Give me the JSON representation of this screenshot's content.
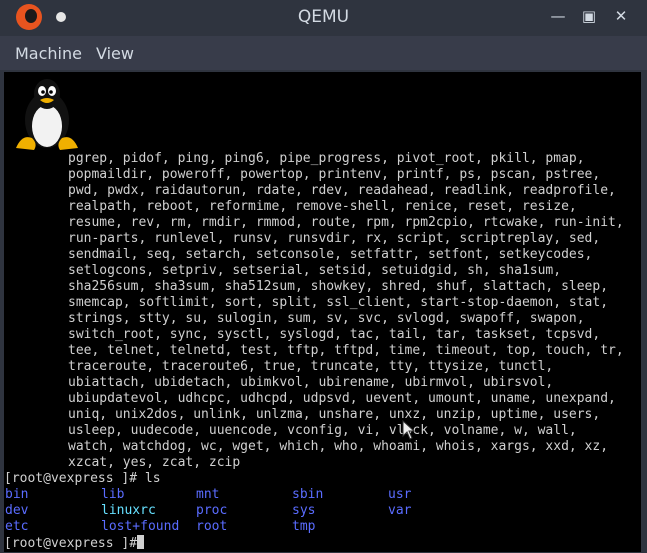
{
  "window": {
    "title": "QEMU",
    "buttons": {
      "minimize": "—",
      "maximize": "▣",
      "close": "✕"
    }
  },
  "menubar": {
    "items": [
      "Machine",
      "View"
    ]
  },
  "console": {
    "busybox_lines": [
      "pgrep, pidof, ping, ping6, pipe_progress, pivot_root, pkill, pmap,",
      "popmaildir, poweroff, powertop, printenv, printf, ps, pscan, pstree,",
      "pwd, pwdx, raidautorun, rdate, rdev, readahead, readlink, readprofile,",
      "realpath, reboot, reformime, remove-shell, renice, reset, resize,",
      "resume, rev, rm, rmdir, rmmod, route, rpm, rpm2cpio, rtcwake, run-init,",
      "run-parts, runlevel, runsv, runsvdir, rx, script, scriptreplay, sed,",
      "sendmail, seq, setarch, setconsole, setfattr, setfont, setkeycodes,",
      "setlogcons, setpriv, setserial, setsid, setuidgid, sh, sha1sum,",
      "sha256sum, sha3sum, sha512sum, showkey, shred, shuf, slattach, sleep,",
      "smemcap, softlimit, sort, split, ssl_client, start-stop-daemon, stat,",
      "strings, stty, su, sulogin, sum, sv, svc, svlogd, swapoff, swapon,",
      "switch_root, sync, sysctl, syslogd, tac, tail, tar, taskset, tcpsvd,",
      "tee, telnet, telnetd, test, tftp, tftpd, time, timeout, top, touch, tr,",
      "traceroute, traceroute6, true, truncate, tty, ttysize, tunctl,",
      "ubiattach, ubidetach, ubimkvol, ubirename, ubirmvol, ubirsvol,",
      "ubiupdatevol, udhcpc, udhcpd, udpsvd, uevent, umount, uname, unexpand,",
      "uniq, unix2dos, unlink, unlzma, unshare, unxz, unzip, uptime, users,",
      "usleep, uudecode, uuencode, vconfig, vi, vlock, volname, w, wall,",
      "watch, watchdog, wc, wget, which, who, whoami, whois, xargs, xxd, xz,",
      "xzcat, yes, zcat, zcip"
    ],
    "ls_command": "[root@vexpress ]# ls",
    "ls_rows": [
      [
        {
          "name": "bin",
          "kind": "dir"
        },
        {
          "name": "lib",
          "kind": "dir"
        },
        {
          "name": "mnt",
          "kind": "dir"
        },
        {
          "name": "sbin",
          "kind": "dir"
        },
        {
          "name": "usr",
          "kind": "dir"
        }
      ],
      [
        {
          "name": "dev",
          "kind": "dir"
        },
        {
          "name": "linuxrc",
          "kind": "link"
        },
        {
          "name": "proc",
          "kind": "dir"
        },
        {
          "name": "sys",
          "kind": "dir"
        },
        {
          "name": "var",
          "kind": "dir"
        }
      ],
      [
        {
          "name": "etc",
          "kind": "dir"
        },
        {
          "name": "lost+found",
          "kind": "dir"
        },
        {
          "name": "root",
          "kind": "dir"
        },
        {
          "name": "tmp",
          "kind": "dir"
        }
      ]
    ],
    "prompt": "[root@vexpress ]#",
    "colors": {
      "text": "#d0d0d0",
      "directory": "#5a6cff",
      "symlink": "#66e0ff",
      "background": "#000000"
    }
  }
}
